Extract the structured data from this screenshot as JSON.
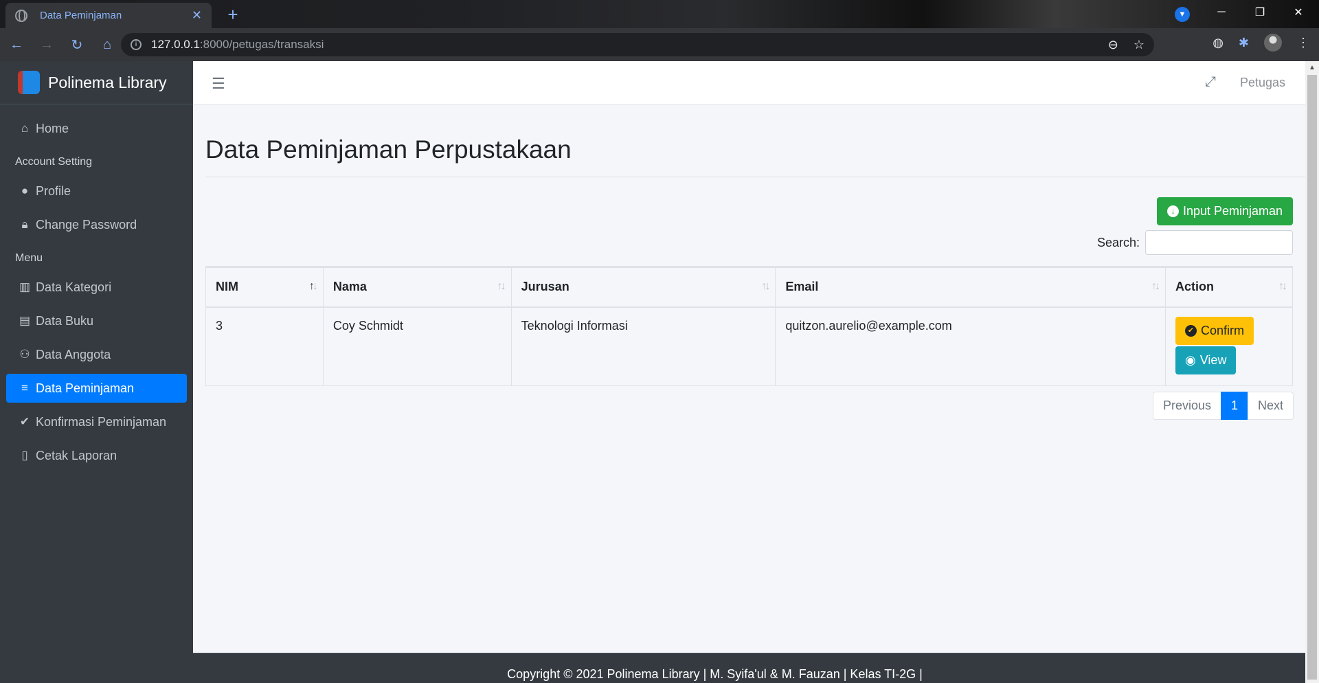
{
  "browser": {
    "tab_title": "Data Peminjaman",
    "url_host": "127.0.0.1",
    "url_rest": ":8000/petugas/transaksi"
  },
  "sidebar": {
    "brand": "Polinema Library",
    "home": "Home",
    "account_header": "Account Setting",
    "profile": "Profile",
    "change_password": "Change Password",
    "menu_header": "Menu",
    "items": [
      {
        "label": "Data Kategori"
      },
      {
        "label": "Data Buku"
      },
      {
        "label": "Data Anggota"
      },
      {
        "label": "Data Peminjaman"
      },
      {
        "label": "Konfirmasi Peminjaman"
      },
      {
        "label": "Cetak Laporan"
      }
    ]
  },
  "topnav": {
    "user": "Petugas"
  },
  "main": {
    "title": "Data Peminjaman Perpustakaan",
    "input_button": "Input Peminjaman",
    "search_label": "Search:",
    "search_value": "",
    "columns": [
      "NIM",
      "Nama",
      "Jurusan",
      "Email",
      "Action"
    ],
    "rows": [
      {
        "nim": "3",
        "nama": "Coy Schmidt",
        "jurusan": "Teknologi Informasi",
        "email": "quitzon.aurelio@example.com"
      }
    ],
    "confirm_label": "Confirm",
    "view_label": "View",
    "pagination": {
      "previous": "Previous",
      "current": "1",
      "next": "Next"
    }
  },
  "footer": {
    "text": "Copyright © 2021 Polinema Library | M. Syifa'ul & M. Fauzan | Kelas TI-2G |"
  },
  "colors": {
    "primary": "#007bff",
    "success": "#28a745",
    "warning": "#ffc107",
    "info": "#17a2b8",
    "sidebar": "#343a40"
  }
}
